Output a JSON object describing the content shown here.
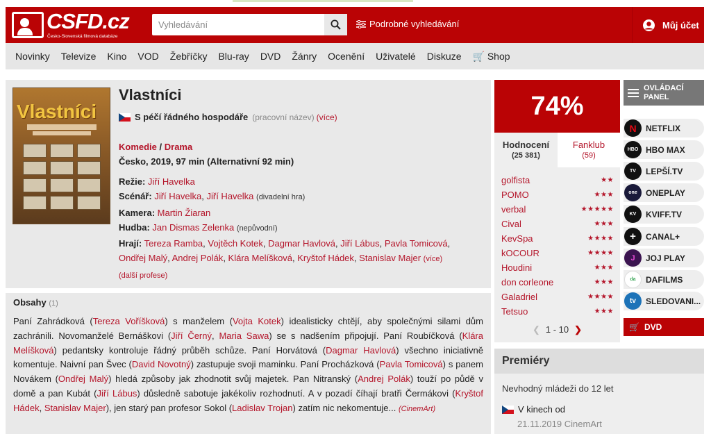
{
  "header": {
    "logo_text": "CSFD.cz",
    "logo_sub": "Česko-Slovenská filmová databáze",
    "search_placeholder": "Vyhledávání",
    "advanced_search": "Podrobné vyhledávání",
    "account": "Můj účet"
  },
  "nav": [
    "Novinky",
    "Televize",
    "Kino",
    "VOD",
    "Žebříčky",
    "Blu-ray",
    "DVD",
    "Žánry",
    "Ocenění",
    "Uživatelé",
    "Diskuze",
    "Shop"
  ],
  "film": {
    "poster_title": "Vlastníci",
    "title": "Vlastníci",
    "alt_title": "S péčí řádného hospodáře",
    "alt_note": "(pracovní název)",
    "alt_more": "(více)",
    "genre1": "Komedie",
    "genre_sep": " / ",
    "genre2": "Drama",
    "origin": "Česko, 2019, 97 min (Alternativní 92 min)",
    "rezie_label": "Režie:",
    "rezie": "Jiří Havelka",
    "scenar_label": "Scénář:",
    "scenar1": "Jiří Havelka",
    "scenar2": "Jiří Havelka",
    "scenar_note": "(divadelní hra)",
    "kamera_label": "Kamera:",
    "kamera": "Martin Žiaran",
    "hudba_label": "Hudba:",
    "hudba": "Jan Dismas Zelenka",
    "hudba_note": "(nepůvodní)",
    "hraji_label": "Hrají:",
    "cast": [
      "Tereza Ramba",
      "Vojtěch Kotek",
      "Dagmar Havlová",
      "Jiří Lábus",
      "Pavla Tomicová",
      "Ondřej Malý",
      "Andrej Polák",
      "Klára Melíšková",
      "Kryštof Hádek",
      "Stanislav Majer"
    ],
    "cast_more": "(více)",
    "more_profs": "(další profese)"
  },
  "plot": {
    "heading": "Obsahy",
    "count": "(1)",
    "source": "(CinemArt)"
  },
  "rating": {
    "score": "74%",
    "tab1_label": "Hodnocení",
    "tab1_count": "(25 381)",
    "tab2_label": "Fanklub",
    "tab2_count": "(59)",
    "users": [
      {
        "name": "golfista",
        "stars": "★★"
      },
      {
        "name": "POMO",
        "stars": "★★★"
      },
      {
        "name": "verbal",
        "stars": "★★★★★"
      },
      {
        "name": "Cival",
        "stars": "★★★"
      },
      {
        "name": "KevSpa",
        "stars": "★★★★"
      },
      {
        "name": "kOCOUR",
        "stars": "★★★★"
      },
      {
        "name": "Houdini",
        "stars": "★★★"
      },
      {
        "name": "don corleone",
        "stars": "★★★"
      },
      {
        "name": "Galadriel",
        "stars": "★★★★"
      },
      {
        "name": "Tetsuo",
        "stars": "★★★"
      }
    ],
    "pager": "1 - 10"
  },
  "premiery": {
    "heading": "Premiéry",
    "age": "Nevhodný mládeži do 12 let",
    "cinema": "V kinech od",
    "date": "21.11.2019 CinemArt"
  },
  "panel": {
    "label1": "OVLÁDACÍ",
    "label2": "PANEL"
  },
  "vod": [
    {
      "name": "NETFLIX",
      "icon": "N",
      "color": "#111111"
    },
    {
      "name": "HBO MAX",
      "icon": "HBO",
      "color": "#111111"
    },
    {
      "name": "LEPŠÍ.TV",
      "icon": "TV",
      "color": "#111111"
    },
    {
      "name": "ONEPLAY",
      "icon": "one",
      "color": "#1a1a3a"
    },
    {
      "name": "KVIFF.TV",
      "icon": "KV",
      "color": "#111111"
    },
    {
      "name": "CANAL+",
      "icon": "+",
      "color": "#111111"
    },
    {
      "name": "JOJ PLAY",
      "icon": "J",
      "color": "#3b1450"
    },
    {
      "name": "DAFILMS",
      "icon": "da",
      "color": "#ffffff"
    },
    {
      "name": "SLEDOVANI...",
      "icon": "tv",
      "color": "#1d73b8"
    }
  ],
  "dvd": "DVD",
  "colors": {
    "brand": "#ba0305",
    "link": "#b4152a"
  }
}
